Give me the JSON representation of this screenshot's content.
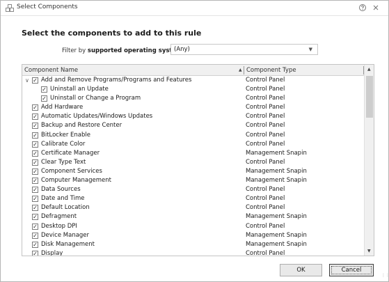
{
  "window": {
    "title": "Select Components",
    "help_icon": "help-icon",
    "close_icon": "close-icon"
  },
  "heading": "Select the components to add to this rule",
  "filter": {
    "label_prefix": "Filter by",
    "label_bold": "supported operating systems",
    "value": "(Any)"
  },
  "grid": {
    "columns": {
      "name": "Component Name",
      "type": "Component Type"
    },
    "rows": [
      {
        "name": "Add and Remove Programs/Programs and Features",
        "type": "Control Panel",
        "level": 0,
        "expandable": true
      },
      {
        "name": "Uninstall an Update",
        "type": "Control Panel",
        "level": 1
      },
      {
        "name": "Uninstall or Change a Program",
        "type": "Control Panel",
        "level": 1
      },
      {
        "name": "Add Hardware",
        "type": "Control Panel",
        "level": 0
      },
      {
        "name": "Automatic Updates/Windows Updates",
        "type": "Control Panel",
        "level": 0
      },
      {
        "name": "Backup and Restore Center",
        "type": "Control Panel",
        "level": 0
      },
      {
        "name": "BitLocker Enable",
        "type": "Control Panel",
        "level": 0
      },
      {
        "name": "Calibrate Color",
        "type": "Control Panel",
        "level": 0
      },
      {
        "name": "Certificate Manager",
        "type": "Management Snapin",
        "level": 0
      },
      {
        "name": "Clear Type Text",
        "type": "Control Panel",
        "level": 0
      },
      {
        "name": "Component Services",
        "type": "Management Snapin",
        "level": 0
      },
      {
        "name": "Computer Management",
        "type": "Management Snapin",
        "level": 0
      },
      {
        "name": "Data Sources",
        "type": "Control Panel",
        "level": 0
      },
      {
        "name": "Date and Time",
        "type": "Control Panel",
        "level": 0
      },
      {
        "name": "Default Location",
        "type": "Control Panel",
        "level": 0
      },
      {
        "name": "Defragment",
        "type": "Management Snapin",
        "level": 0
      },
      {
        "name": "Desktop DPI",
        "type": "Control Panel",
        "level": 0
      },
      {
        "name": "Device Manager",
        "type": "Management Snapin",
        "level": 0
      },
      {
        "name": "Disk Management",
        "type": "Management Snapin",
        "level": 0
      },
      {
        "name": "Display",
        "type": "Control Panel",
        "level": 0
      }
    ]
  },
  "buttons": {
    "ok": "OK",
    "cancel": "Cancel"
  }
}
